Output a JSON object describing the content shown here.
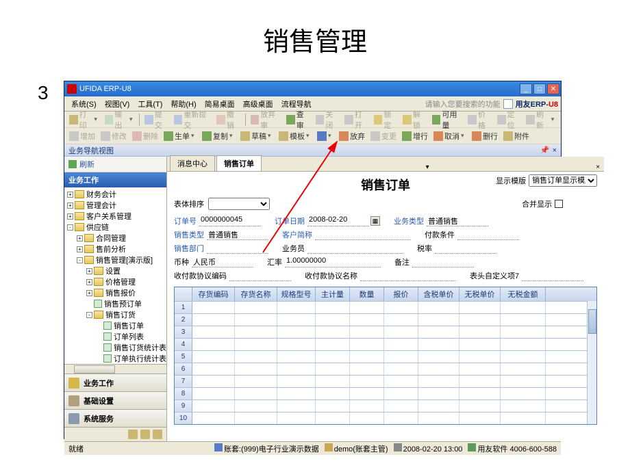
{
  "slide": {
    "title": "销售管理",
    "number": "3"
  },
  "window": {
    "title": "UFIDA ERP-U8"
  },
  "menubar": {
    "items": [
      "系统(S)",
      "视图(V)",
      "工具(T)",
      "帮助(H)"
    ],
    "links": [
      "简易桌面",
      "高级桌面",
      "流程导航"
    ],
    "search_hint": "请输入您要搜索的功能",
    "brand": "用友ERP-"
  },
  "toolbar1": {
    "items": [
      "打印",
      "输出",
      "",
      "提交",
      "重新提交",
      "撤销",
      "",
      "放弃审",
      "查审",
      "关闭",
      "打开",
      "锁定",
      "解锁",
      "可用量",
      "价格",
      "定位",
      "刷新"
    ]
  },
  "toolbar2": {
    "items": [
      "增加",
      "修改",
      "删除",
      "生单",
      "复制",
      "草稿",
      "模板",
      "",
      "放弃",
      "变更",
      "增行",
      "取消",
      "删行",
      "附件"
    ]
  },
  "nav_header": "业务导航视图",
  "sidebar": {
    "refresh": "刷新",
    "section": "业务工作",
    "tree": [
      {
        "lvl": 0,
        "exp": "+",
        "icon": "f",
        "label": "财务会计"
      },
      {
        "lvl": 0,
        "exp": "+",
        "icon": "f",
        "label": "管理会计"
      },
      {
        "lvl": 0,
        "exp": "+",
        "icon": "f",
        "label": "客户关系管理"
      },
      {
        "lvl": 0,
        "exp": "-",
        "icon": "f",
        "label": "供应链"
      },
      {
        "lvl": 1,
        "exp": "+",
        "icon": "f",
        "label": "合同管理"
      },
      {
        "lvl": 1,
        "exp": "+",
        "icon": "f",
        "label": "售前分析"
      },
      {
        "lvl": 1,
        "exp": "-",
        "icon": "f",
        "label": "销售管理[演示版]"
      },
      {
        "lvl": 2,
        "exp": "+",
        "icon": "f",
        "label": "设置"
      },
      {
        "lvl": 2,
        "exp": "+",
        "icon": "f",
        "label": "价格管理"
      },
      {
        "lvl": 2,
        "exp": "+",
        "icon": "f",
        "label": "销售报价"
      },
      {
        "lvl": 2,
        "exp": "",
        "icon": "d",
        "label": "销售预订单"
      },
      {
        "lvl": 2,
        "exp": "-",
        "icon": "f",
        "label": "销售订货"
      },
      {
        "lvl": 3,
        "exp": "",
        "icon": "d",
        "label": "销售订单"
      },
      {
        "lvl": 3,
        "exp": "",
        "icon": "d",
        "label": "订单列表"
      },
      {
        "lvl": 3,
        "exp": "",
        "icon": "d",
        "label": "销售订货统计表"
      },
      {
        "lvl": 3,
        "exp": "",
        "icon": "d",
        "label": "订单执行统计表"
      }
    ],
    "accordion": [
      "业务工作",
      "基础设置",
      "系统服务"
    ]
  },
  "tabs": {
    "items": [
      "消息中心",
      "销售订单"
    ],
    "active": 1
  },
  "doc": {
    "title": "销售订单",
    "display_label": "显示模版",
    "display_value": "销售订单显示模版",
    "sort_label": "表体排序",
    "merge_label": "合并显示",
    "fields": {
      "order_no_lbl": "订单号",
      "order_no": "0000000045",
      "order_date_lbl": "订单日期",
      "order_date": "2008-02-20",
      "biz_type_lbl": "业务类型",
      "biz_type": "普通销售",
      "sale_type_lbl": "销售类型",
      "sale_type": "普通销售",
      "cust_lbl": "客户简称",
      "cust": "",
      "pay_lbl": "付款条件",
      "pay": "",
      "dept_lbl": "销售部门",
      "dept": "",
      "staff_lbl": "业务员",
      "staff": "",
      "tax_lbl": "税率",
      "tax": "",
      "currency_lbl": "币种",
      "currency": "人民币",
      "rate_lbl": "汇率",
      "rate": "1.00000000",
      "memo_lbl": "备注",
      "memo": "",
      "agree_no_lbl": "收付款协议编码",
      "agree_no": "",
      "agree_name_lbl": "收付款协议名称",
      "agree_name": "",
      "udf_lbl": "表头自定义项7",
      "udf": ""
    },
    "grid": {
      "cols": [
        "存货编码",
        "存货名称",
        "规格型号",
        "主计量",
        "数量",
        "报价",
        "含税单价",
        "无税单价",
        "无税金额"
      ],
      "rows": 10
    }
  },
  "status": {
    "ready": "就绪",
    "account": "账套:(999)电子行业演示数据",
    "user": "demo(账套主管)",
    "time": "2008-02-20 13:00",
    "vendor": "用友软件 4006-600-588"
  }
}
